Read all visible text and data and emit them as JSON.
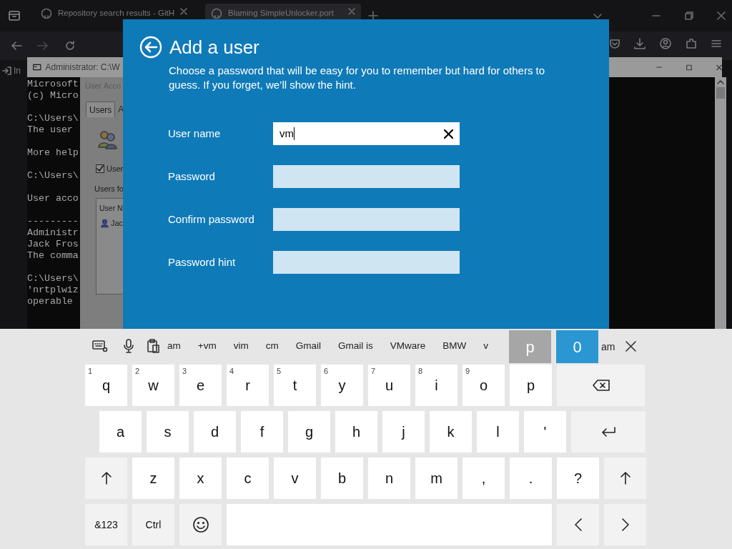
{
  "browser": {
    "tabs": [
      {
        "title": "Repository search results - GitH",
        "selected": false
      },
      {
        "title": "Blaming SimpleUnlocker.port",
        "selected": true
      }
    ],
    "sidebar_label": "In"
  },
  "console": {
    "title": "Administrator: C:\\W",
    "blocks": [
      [
        "Microsoft",
        "(c) Micro"
      ],
      [
        "C:\\Users\\",
        "The user"
      ],
      [
        "More help"
      ],
      [
        "C:\\Users\\"
      ],
      [
        "User acco"
      ],
      [
        "---------",
        "Administr",
        "Jack Fros",
        "The comma"
      ],
      [
        "C:\\Users\\",
        "'nrtplwiz",
        "operable"
      ]
    ]
  },
  "user_accounts": {
    "title": "User Acco",
    "tabs": [
      {
        "label": "Users",
        "selected": true
      },
      {
        "label": "A",
        "selected": false
      }
    ],
    "checkbox": {
      "label": "User",
      "checked": true
    },
    "list_label": "Users fo",
    "column": "User N",
    "rows": [
      "Jac"
    ]
  },
  "dialog": {
    "title": "Add a user",
    "description": "Choose a password that will be easy for you to remember but hard for others to guess. If you forget, we’ll show the hint.",
    "fields": [
      {
        "label": "User name",
        "value": "vm",
        "focused": true
      },
      {
        "label": "Password",
        "focused": false
      },
      {
        "label": "Confirm password",
        "focused": false
      },
      {
        "label": "Password hint",
        "focused": false
      }
    ]
  },
  "keyboard": {
    "suggestions": [
      "am",
      "+vm",
      "vim",
      "cm",
      "Gmail",
      "Gmail is",
      "VMware",
      "BMW",
      "v"
    ],
    "suggestion_after": "am",
    "popup": [
      {
        "label": "p",
        "selected": false
      },
      {
        "label": "0",
        "selected": true
      }
    ],
    "rows": [
      [
        {
          "kind": "char",
          "label": "q",
          "hint": "1"
        },
        {
          "kind": "char",
          "label": "w",
          "hint": "2"
        },
        {
          "kind": "char",
          "label": "e",
          "hint": "3"
        },
        {
          "kind": "char",
          "label": "r",
          "hint": "4"
        },
        {
          "kind": "char",
          "label": "t",
          "hint": "5"
        },
        {
          "kind": "char",
          "label": "y",
          "hint": "6"
        },
        {
          "kind": "char",
          "label": "u",
          "hint": "7"
        },
        {
          "kind": "char",
          "label": "i",
          "hint": "8"
        },
        {
          "kind": "char",
          "label": "o",
          "hint": "9"
        },
        {
          "kind": "char",
          "label": "p"
        },
        {
          "kind": "backspace"
        }
      ],
      [
        {
          "kind": "char",
          "label": "a"
        },
        {
          "kind": "char",
          "label": "s"
        },
        {
          "kind": "char",
          "label": "d"
        },
        {
          "kind": "char",
          "label": "f"
        },
        {
          "kind": "char",
          "label": "g"
        },
        {
          "kind": "char",
          "label": "h"
        },
        {
          "kind": "char",
          "label": "j"
        },
        {
          "kind": "char",
          "label": "k"
        },
        {
          "kind": "char",
          "label": "l"
        },
        {
          "kind": "char",
          "label": "'"
        },
        {
          "kind": "enter"
        }
      ],
      [
        {
          "kind": "shift"
        },
        {
          "kind": "char",
          "label": "z"
        },
        {
          "kind": "char",
          "label": "x"
        },
        {
          "kind": "char",
          "label": "c"
        },
        {
          "kind": "char",
          "label": "v"
        },
        {
          "kind": "char",
          "label": "b"
        },
        {
          "kind": "char",
          "label": "n"
        },
        {
          "kind": "char",
          "label": "m"
        },
        {
          "kind": "char",
          "label": ","
        },
        {
          "kind": "char",
          "label": "."
        },
        {
          "kind": "char",
          "label": "?"
        },
        {
          "kind": "shift"
        }
      ],
      [
        {
          "kind": "func",
          "label": "&123"
        },
        {
          "kind": "func",
          "label": "Ctrl"
        },
        {
          "kind": "emoji"
        },
        {
          "kind": "space"
        },
        {
          "kind": "left"
        },
        {
          "kind": "right"
        }
      ]
    ]
  }
}
